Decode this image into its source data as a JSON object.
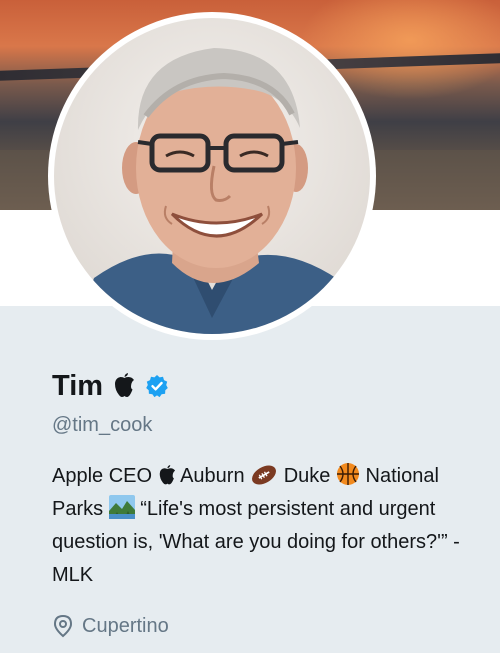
{
  "profile": {
    "name": "Tim",
    "handle": "@tim_cook",
    "bio": {
      "part1": "Apple CEO",
      "part2": "Auburn",
      "part3": "Duke",
      "part4": "National Parks",
      "part5": "“Life's most persistent and urgent question is, 'What are you doing for others?'” - MLK"
    },
    "location": "Cupertino",
    "verified": true
  },
  "colors": {
    "accent": "#1da1f2",
    "text": "#14171a",
    "secondary": "#657786",
    "background": "#e6ecf0"
  },
  "icons": [
    "apple-logo-icon",
    "verified-badge-icon",
    "football-icon",
    "basketball-icon",
    "national-park-icon",
    "location-pin-icon"
  ]
}
